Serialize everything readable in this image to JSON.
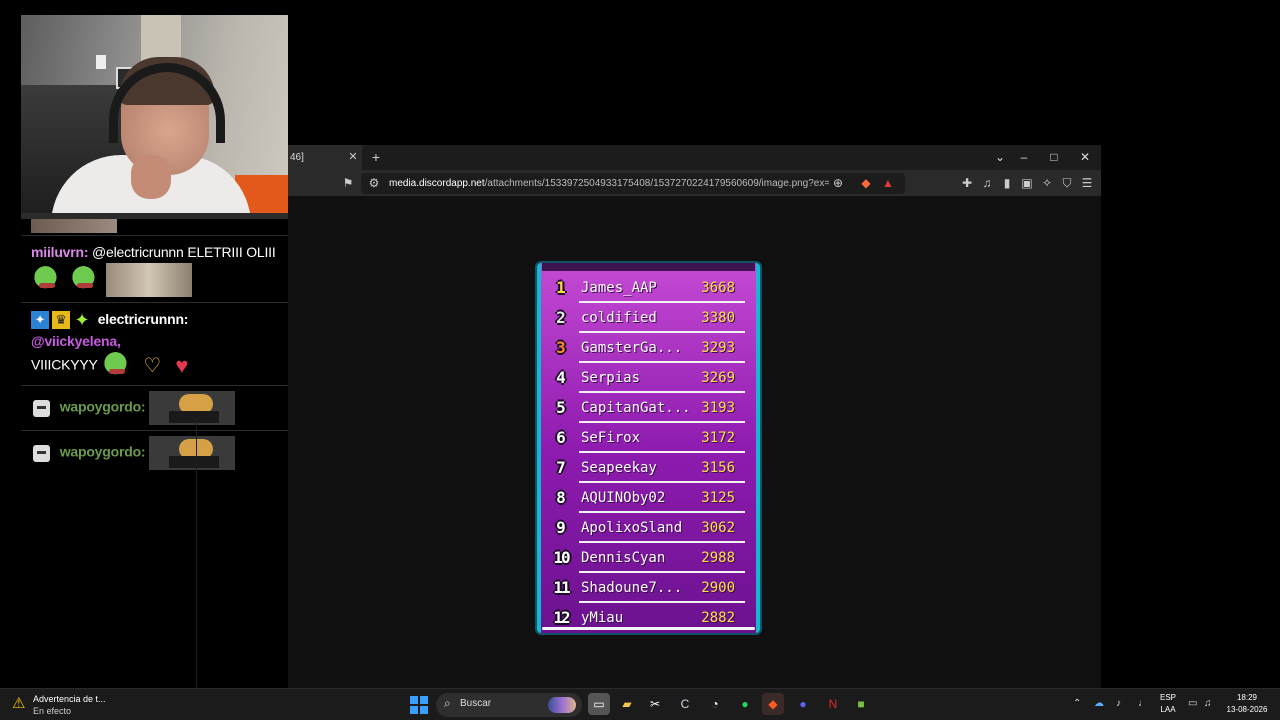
{
  "chat": {
    "messages": [
      {
        "user": "miiluvrn:",
        "user_color": "#d98ae6",
        "mention": "@electricrunnn",
        "text": "ELETRIII OLIII"
      },
      {
        "user": "electricrunnn:",
        "user_color": "#ffffff",
        "mention": "@viickyelena,",
        "text": "VIIICKYYY"
      },
      {
        "user": "wapoygordo:",
        "user_color": "#6b9b4a"
      },
      {
        "user": "wapoygordo:",
        "user_color": "#6b9b4a"
      }
    ]
  },
  "browser": {
    "tab_title": "46]",
    "new_tab": "+",
    "url_host": "media.discordapp.net",
    "url_path": "/attachments/1533972504933175408/1537270224179560609/image.png?ex=6a7f...",
    "controls": {
      "dropdown": "⌄",
      "minimize": "–",
      "maximize": "□",
      "close": "✕"
    }
  },
  "leaderboard": [
    {
      "rank": "1",
      "name": "James_AAP",
      "score": "3668"
    },
    {
      "rank": "2",
      "name": "coldified",
      "score": "3380"
    },
    {
      "rank": "3",
      "name": "GamsterGa...",
      "score": "3293"
    },
    {
      "rank": "4",
      "name": "Serpias",
      "score": "3269"
    },
    {
      "rank": "5",
      "name": "CapitanGat...",
      "score": "3193"
    },
    {
      "rank": "6",
      "name": "SeFirox",
      "score": "3172"
    },
    {
      "rank": "7",
      "name": "Seapeekay",
      "score": "3156"
    },
    {
      "rank": "8",
      "name": "AQUINOby02",
      "score": "3125"
    },
    {
      "rank": "9",
      "name": "ApolixoSland",
      "score": "3062"
    },
    {
      "rank": "10",
      "name": "DennisCyan",
      "score": "2988"
    },
    {
      "rank": "11",
      "name": "Shadoune7...",
      "score": "2900"
    },
    {
      "rank": "12",
      "name": "yMiau",
      "score": "2882"
    }
  ],
  "taskbar": {
    "notification_title": "Advertencia de t...",
    "notification_status": "En efecto",
    "search_placeholder": "Buscar",
    "language_line1": "ESP",
    "language_line2": "LAA",
    "time": "18:29",
    "date": "13-08-2026"
  }
}
